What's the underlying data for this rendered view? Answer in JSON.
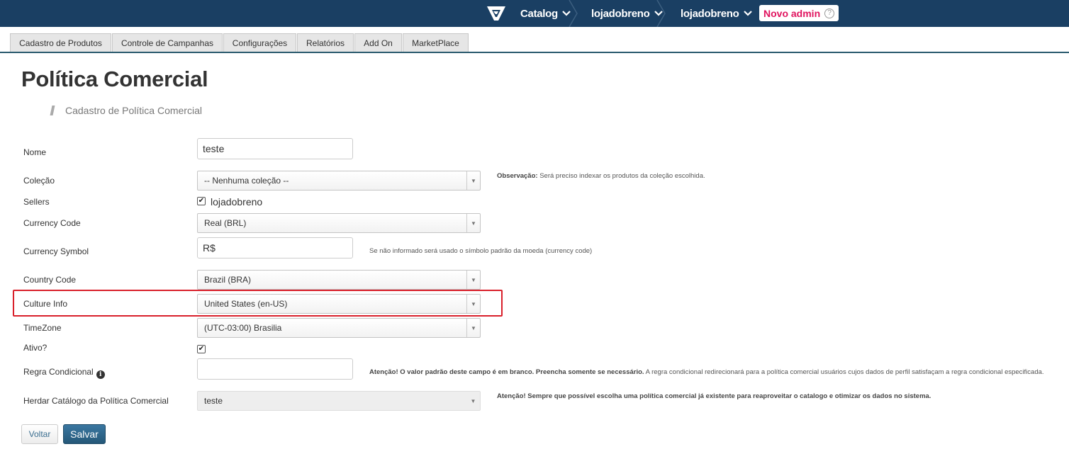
{
  "topbar": {
    "logo": "vtex-logo-icon",
    "breadcrumbs": [
      {
        "label": "Catalog"
      },
      {
        "label": "lojadobreno"
      },
      {
        "label": "lojadobreno"
      }
    ],
    "admin_button": "Novo admin",
    "help_icon": "question-circle-icon"
  },
  "menu": {
    "tabs": [
      {
        "label": "Cadastro de Produtos"
      },
      {
        "label": "Controle de Campanhas"
      },
      {
        "label": "Configurações"
      },
      {
        "label": "Relatórios"
      },
      {
        "label": "Add On"
      },
      {
        "label": "MarketPlace"
      }
    ]
  },
  "page": {
    "title": "Política Comercial",
    "subtitle": "Cadastro de Política Comercial"
  },
  "form": {
    "nome": {
      "label": "Nome",
      "value": "teste"
    },
    "colecao": {
      "label": "Coleção",
      "selected": "-- Nenhuma coleção --",
      "note_bold": "Observação:",
      "note_text": " Será preciso indexar os produtos da coleção escolhida."
    },
    "sellers": {
      "label": "Sellers",
      "option": "lojadobreno",
      "checked": true
    },
    "currency_code": {
      "label": "Currency Code",
      "selected": "Real (BRL)"
    },
    "currency_symbol": {
      "label": "Currency Symbol",
      "value": "R$",
      "note": "Se não informado será usado o símbolo padrão da moeda (currency code)"
    },
    "country_code": {
      "label": "Country Code",
      "selected": "Brazil (BRA)"
    },
    "culture_info": {
      "label": "Culture Info",
      "selected": "United States (en-US)"
    },
    "timezone": {
      "label": "TimeZone",
      "selected": "(UTC-03:00) Brasilia"
    },
    "ativo": {
      "label": "Ativo?",
      "checked": true
    },
    "regra_condicional": {
      "label": "Regra Condicional",
      "value": "",
      "info_icon": "info-circle-icon",
      "note_bold": "Atenção! O valor padrão deste campo é em branco. Preencha somente se necessário.",
      "note_text": " A regra condicional redirecionará para a política comercial usuários cujos dados de perfil satisfaçam a regra condicional especificada."
    },
    "herdar_catalogo": {
      "label": "Herdar Catálogo da Política Comercial",
      "selected": "teste",
      "note_bold": "Atenção! Sempre que possível escolha uma política comercial já existente para reaproveitar o catalogo e otimizar os dados no sistema."
    }
  },
  "buttons": {
    "back": "Voltar",
    "save": "Salvar"
  },
  "colors": {
    "topbar": "#1a3f63",
    "admin_text": "#e0135e",
    "highlight": "#d9202b",
    "save_button": "#2d6689"
  }
}
